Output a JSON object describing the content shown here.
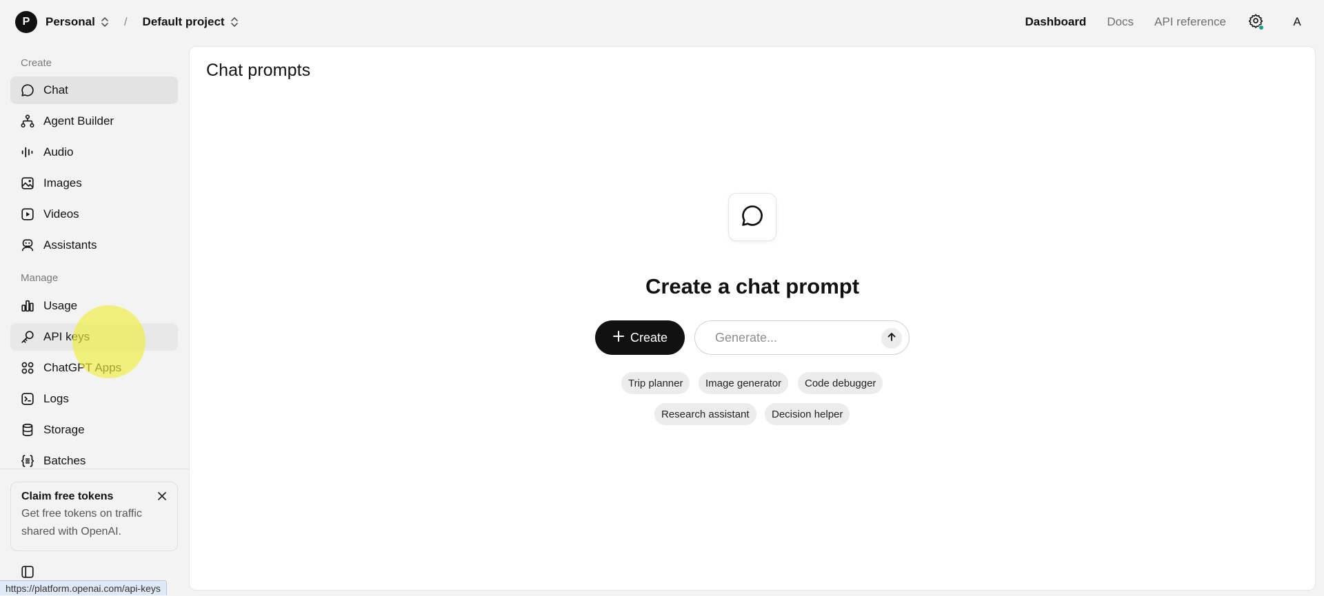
{
  "topbar": {
    "org_initial": "P",
    "org_name": "Personal",
    "separator": "/",
    "project_name": "Default project",
    "nav": {
      "dashboard": "Dashboard",
      "docs": "Docs",
      "api_reference": "API reference"
    },
    "user_initial": "A",
    "status_dot_color": "#10a37f"
  },
  "sidebar": {
    "create_label": "Create",
    "manage_label": "Manage",
    "create_items": [
      {
        "label": "Chat",
        "icon": "chat-bubble-icon",
        "active": true
      },
      {
        "label": "Agent Builder",
        "icon": "agent-nodes-icon"
      },
      {
        "label": "Audio",
        "icon": "audio-wave-icon"
      },
      {
        "label": "Images",
        "icon": "image-icon"
      },
      {
        "label": "Videos",
        "icon": "video-play-icon"
      },
      {
        "label": "Assistants",
        "icon": "robot-icon"
      }
    ],
    "manage_items": [
      {
        "label": "Usage",
        "icon": "bar-chart-icon"
      },
      {
        "label": "API keys",
        "icon": "key-icon",
        "hover": true
      },
      {
        "label": "ChatGPT Apps",
        "icon": "apps-grid-icon"
      },
      {
        "label": "Logs",
        "icon": "terminal-icon"
      },
      {
        "label": "Storage",
        "icon": "database-icon"
      },
      {
        "label": "Batches",
        "icon": "braces-icon"
      }
    ],
    "promo": {
      "title": "Claim free tokens",
      "text": "Get free tokens on traffic shared with OpenAI."
    }
  },
  "main": {
    "title": "Chat prompts",
    "empty_title": "Create a chat prompt",
    "create_label": "Create",
    "generate_placeholder": "Generate...",
    "chips": [
      "Trip planner",
      "Image generator",
      "Code debugger",
      "Research assistant",
      "Decision helper"
    ]
  },
  "status_bar": {
    "url": "https://platform.openai.com/api-keys"
  }
}
